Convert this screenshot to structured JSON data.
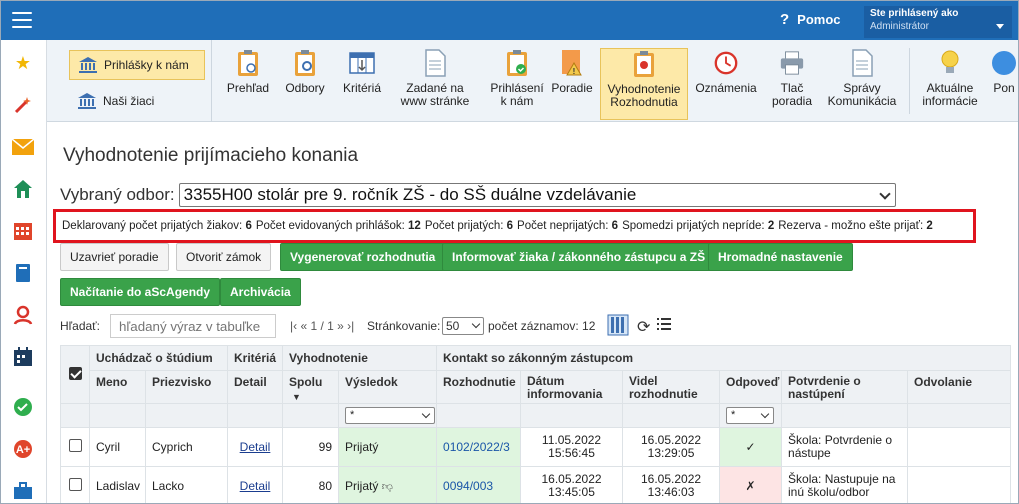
{
  "topbar": {
    "help_label": "Pomoc",
    "user_line1": "Ste prihlásený ako",
    "user_line2": "Administrátor"
  },
  "toolbar": {
    "left": [
      "Prihlášky k nám",
      "Naši žiaci"
    ],
    "items": [
      {
        "l1": "Prehľad",
        "l2": ""
      },
      {
        "l1": "Odbory",
        "l2": ""
      },
      {
        "l1": "Kritériá",
        "l2": ""
      },
      {
        "l1": "Zadané na",
        "l2": "www stránke"
      },
      {
        "l1": "Prihlásení",
        "l2": "k nám"
      },
      {
        "l1": "Poradie",
        "l2": ""
      },
      {
        "l1": "Vyhodnotenie",
        "l2": "Rozhodnutia"
      },
      {
        "l1": "Oznámenia",
        "l2": ""
      },
      {
        "l1": "Tlač",
        "l2": "poradia"
      },
      {
        "l1": "Správy",
        "l2": "Komunikácia"
      },
      {
        "l1": "Aktuálne",
        "l2": "informácie"
      },
      {
        "l1": "Pon",
        "l2": ""
      }
    ]
  },
  "page": {
    "title": "Vyhodnotenie prijímacieho konania",
    "odbor_label": "Vybraný odbor:",
    "odbor_value": "3355H00 stolár pre 9. ročník ZŠ - do SŠ duálne vzdelávanie"
  },
  "stats": {
    "l1": "Deklarovaný počet prijatých žiakov:",
    "v1": "6",
    "l2": "Počet evidovaných prihlášok:",
    "v2": "12",
    "l3": "Počet prijatých:",
    "v3": "6",
    "l4": "Počet neprijatých:",
    "v4": "6",
    "l5": "Spomedzi prijatých neprídе:",
    "v5": "2",
    "l6": "Rezerva - možno ešte prijať:",
    "v6": "2"
  },
  "buttons": {
    "close_order": "Uzavrieť poradie",
    "open_lock": "Otvoriť zámok",
    "generate": "Vygenerovať rozhodnutia",
    "inform": "Informovať žiaka / zákonného zástupcu a ZŠ",
    "bulk": "Hromadné nastavenie",
    "load": "Načítanie do aScAgendy",
    "archive": "Archivácia"
  },
  "search": {
    "label": "Hľadať:",
    "placeholder": "hľadaný výraz v tabuľke",
    "pager": "|‹ « 1 / 1 » ›|",
    "page_label": "Stránkovanie:",
    "page_size": "50",
    "count_label": "počet záznamov: 12"
  },
  "table": {
    "group_headers": [
      "Uchádzač o štúdium",
      "Kritériá",
      "Vyhodnotenie",
      "Kontakt so zákonným zástupcom"
    ],
    "col_headers": [
      "Meno",
      "Priezvisko",
      "Detail",
      "Spolu",
      "Výsledok",
      "Rozhodnutie",
      "Dátum informovania",
      "Videl rozhodnutie",
      "Odpoveď",
      "Potvrdenie o nastúpení",
      "Odvolanie"
    ],
    "filter_value": "*",
    "rows": [
      {
        "meno": "Cyril",
        "priezvisko": "Cyprich",
        "detail": "Detail",
        "spolu": "99",
        "vysledok": "Prijatý",
        "rozhodnutie": "0102/2022/3",
        "datum_d": "11.05.2022",
        "datum_t": "15:56:45",
        "videl_d": "16.05.2022",
        "videl_t": "13:29:05",
        "odpoved": "✓",
        "potvrdenie": "Škola: Potvrdenie o nástupe",
        "odvolanie": ""
      },
      {
        "meno": "Ladislav",
        "priezvisko": "Lacko",
        "detail": "Detail",
        "spolu": "80",
        "vysledok": "Prijatý",
        "rozhodnutie": "0094/003",
        "datum_d": "16.05.2022",
        "datum_t": "13:45:05",
        "videl_d": "16.05.2022",
        "videl_t": "13:46:03",
        "odpoved": "✗",
        "potvrdenie": "Škola: Nastupuje na inú školu/odbor",
        "odvolanie": ""
      }
    ]
  }
}
